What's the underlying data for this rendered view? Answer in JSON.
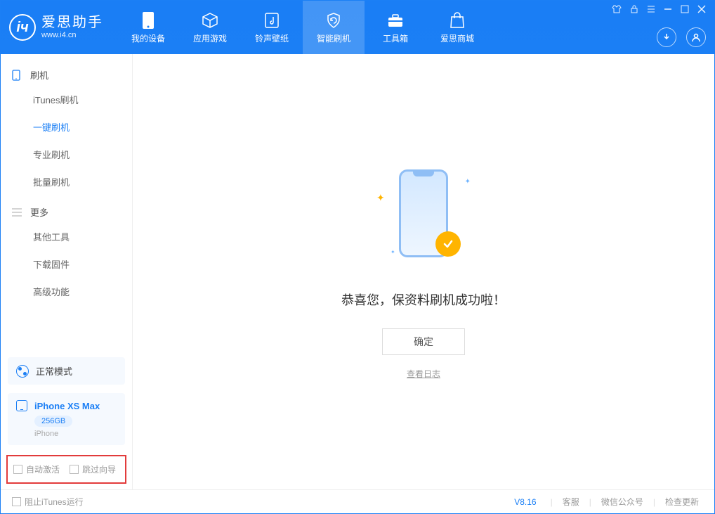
{
  "app": {
    "title": "爱思助手",
    "subtitle": "www.i4.cn"
  },
  "nav": {
    "device": "我的设备",
    "apps": "应用游戏",
    "ringtones": "铃声壁纸",
    "flash": "智能刷机",
    "toolbox": "工具箱",
    "store": "爱思商城"
  },
  "sidebar": {
    "group_flash": "刷机",
    "items_flash": {
      "itunes": "iTunes刷机",
      "oneclick": "一键刷机",
      "pro": "专业刷机",
      "batch": "批量刷机"
    },
    "group_more": "更多",
    "items_more": {
      "other": "其他工具",
      "firmware": "下载固件",
      "advanced": "高级功能"
    }
  },
  "mode": {
    "label": "正常模式"
  },
  "device": {
    "name": "iPhone XS Max",
    "capacity": "256GB",
    "type": "iPhone"
  },
  "bottom_opts": {
    "auto_activate": "自动激活",
    "skip_guide": "跳过向导"
  },
  "main": {
    "success_text": "恭喜您，保资料刷机成功啦！",
    "ok": "确定",
    "view_log": "查看日志"
  },
  "footer": {
    "block_itunes": "阻止iTunes运行",
    "version": "V8.16",
    "support": "客服",
    "wechat": "微信公众号",
    "update": "检查更新"
  }
}
